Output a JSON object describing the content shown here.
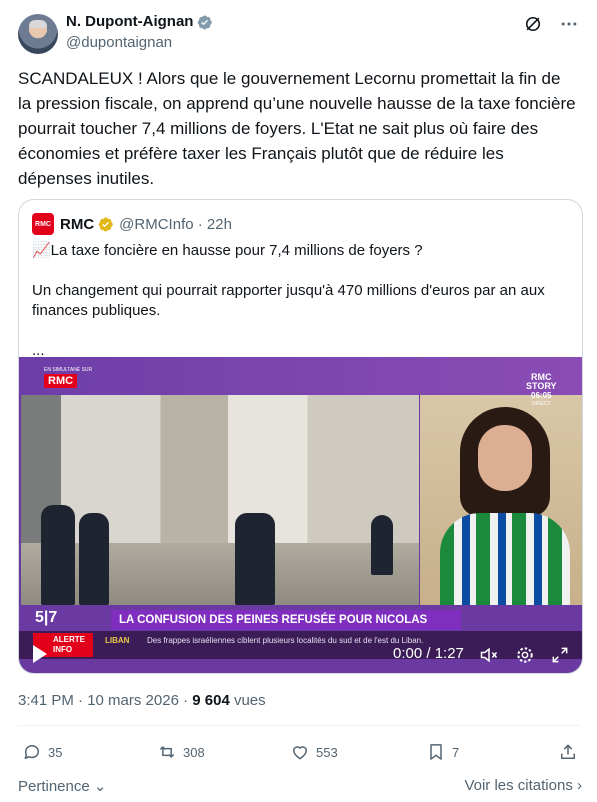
{
  "author": {
    "name": "N. Dupont-Aignan",
    "handle": "@dupontaignan"
  },
  "tweet": {
    "text": "SCANDALEUX ! Alors que le gouvernement Lecornu promettait la fin de la pression fiscale, on apprend qu’une nouvelle hausse de la taxe foncière pourrait toucher 7,4 millions de foyers. L'Etat ne sait plus où faire des économies et préfère taxer les Français plutôt que de réduire les dépenses inutiles."
  },
  "quote": {
    "name": "RMC",
    "logo_text": "RMC",
    "handle_time": "@RMCInfo · 22h",
    "line1": "📈La taxe foncière en hausse pour 7,4 millions de foyers ?",
    "line2": "Un changement qui pourrait rapporter jusqu'à 470 millions d'euros par an aux finances publiques.",
    "ellipsis": "...",
    "video": {
      "simul": "EN SIMULTANÉ SUR",
      "channel": "RMC",
      "story_line1": "RMC",
      "story_line2": "STORY",
      "story_time": "06:05",
      "story_direct": "DIRECT",
      "show": "5|7",
      "banner": "LA CONFUSION DES PEINES REFUSÉE POUR NICOLAS SARKOZY",
      "alerte": "ALERTE INFO",
      "liban": "LIBAN",
      "ticker": "Des frappes israéliennes ciblent plusieurs localités du sud et de l'est du Liban.",
      "duration": "0:00 / 1:27"
    }
  },
  "meta": {
    "time": "3:41 PM · 10 mars 2026 · ",
    "views_count": "9 604",
    "views_label": " vues"
  },
  "actions": {
    "replies": "35",
    "reposts": "308",
    "likes": "553",
    "bookmarks": "7"
  },
  "footer": {
    "sort": "Pertinence",
    "citations": "Voir les citations"
  },
  "colors": {
    "verified_blue": "#1d9bf0",
    "verified_gold": "#e2b719",
    "text_secondary": "#536471",
    "video_purple": "#7f2ec0"
  }
}
